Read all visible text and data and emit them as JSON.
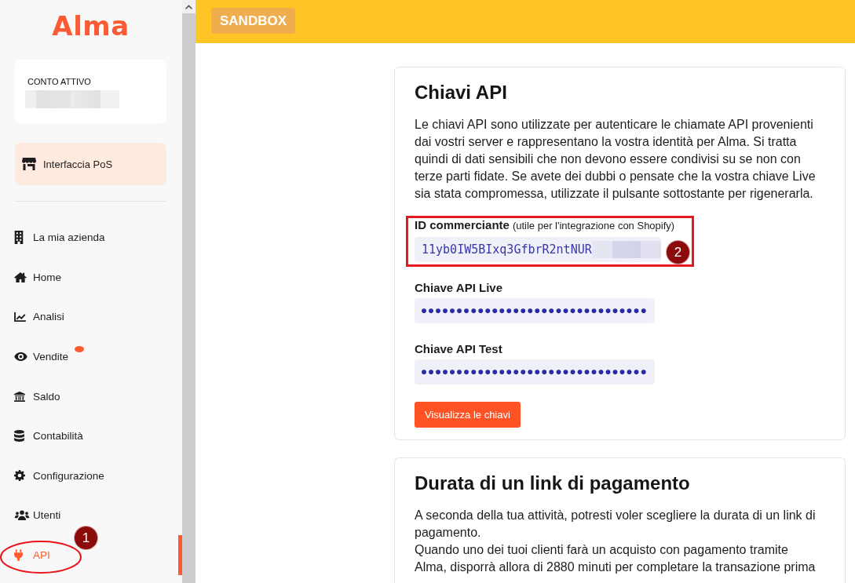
{
  "sidebar": {
    "logo": "Alma",
    "account": {
      "label": "CONTO ATTIVO",
      "redacted": true
    },
    "pos_button": {
      "label": "Interfaccia PoS"
    },
    "nav_items": [
      {
        "label": "La mia azienda",
        "selected": false,
        "notification": false
      },
      {
        "label": "Home",
        "selected": false,
        "notification": false
      },
      {
        "label": "Analisi",
        "selected": false,
        "notification": false
      },
      {
        "label": "Vendite",
        "selected": false,
        "notification": true
      },
      {
        "label": "Saldo",
        "selected": false,
        "notification": false
      },
      {
        "label": "Contabilità",
        "selected": false,
        "notification": false
      },
      {
        "label": "Configurazione",
        "selected": false,
        "notification": false
      },
      {
        "label": "Utenti",
        "selected": false,
        "notification": false
      },
      {
        "label": "API",
        "selected": true,
        "notification": false,
        "annotation": "1"
      }
    ]
  },
  "top_bar": {
    "environment_badge": "SANDBOX"
  },
  "cards": [
    {
      "title": "Chiavi API",
      "paragraphs": [
        "Le chiavi API sono utilizzate per autenticare le chiamate API provenienti dai vostri server e rappresentano la vostra identità per Alma. Si tratta quindi di dati sensibili che non devono essere condivisi su se non con terze parti fidate. Se avete dei dubbi o pensate che la vostra chiave Live sia stata compromessa, utilizzate il pulsante sottostante per rigenerarla."
      ],
      "fields": [
        {
          "label": "ID commerciante",
          "hint": "(utile per l'integrazione con Shopify)",
          "value": "11yb0IW5BIxq3GfbrR2ntNUR",
          "masked": false,
          "redacted": true,
          "annotation": "2"
        },
        {
          "label": "Chiave API Live",
          "value": "●●●●●●●●●●●●●●●●●●●●●●●●●●●●●●●●",
          "masked": true,
          "redacted": false
        },
        {
          "label": "Chiave API Test",
          "value": "●●●●●●●●●●●●●●●●●●●●●●●●●●●●●●●●",
          "masked": true,
          "redacted": false
        }
      ],
      "button": "Visualizza le chiavi"
    },
    {
      "title": "Durata di un link di pagamento",
      "paragraphs": [
        "A seconda della tua attività, potresti voler scegliere la durata di un link di pagamento.",
        "Quando uno dei tuoi clienti farà un acquisto con pagamento tramite Alma, disporrà allora di 2880 minuti per completare la transazione prima"
      ]
    }
  ]
}
